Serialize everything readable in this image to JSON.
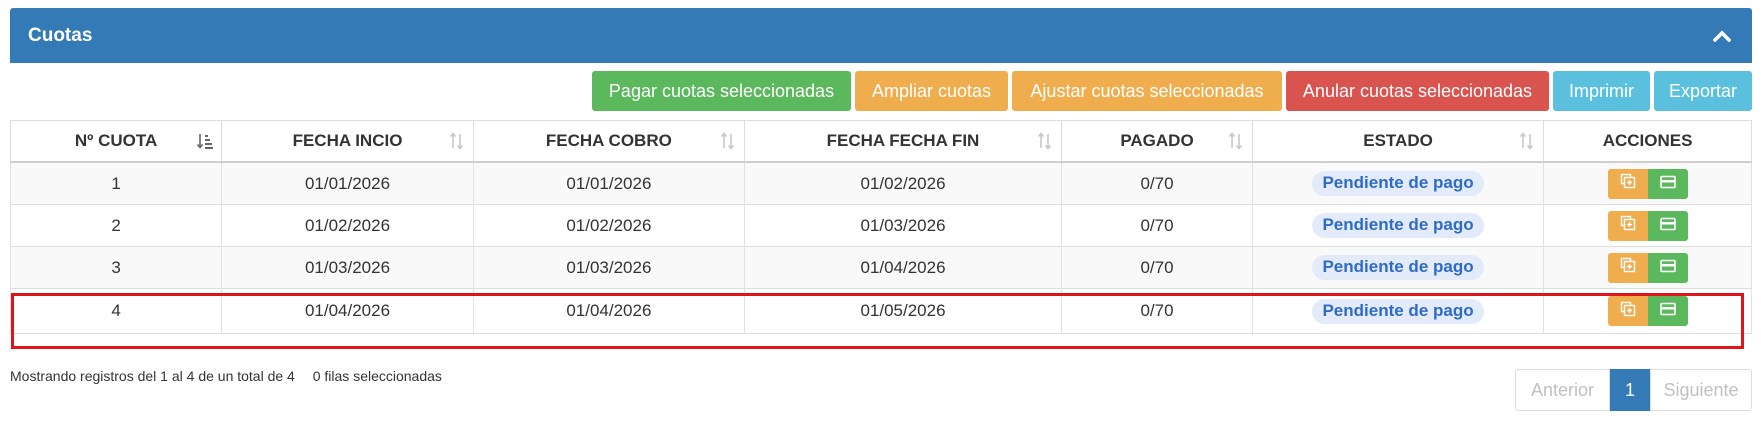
{
  "panel": {
    "title": "Cuotas",
    "collapse_icon": "chevron-up-icon"
  },
  "toolbar": {
    "pay_selected": "Pagar cuotas seleccionadas",
    "extend": "Ampliar cuotas",
    "adjust_selected": "Ajustar cuotas seleccionadas",
    "cancel_selected": "Anular cuotas seleccionadas",
    "print": "Imprimir",
    "export": "Exportar"
  },
  "table": {
    "headers": [
      "Nº CUOTA",
      "FECHA INCIO",
      "FECHA COBRO",
      "FECHA FECHA FIN",
      "PAGADO",
      "ESTADO",
      "ACCIONES"
    ],
    "rows": [
      {
        "cuota": "1",
        "inicio": "01/01/2026",
        "cobro": "01/01/2026",
        "fin": "01/02/2026",
        "pagado": "0/70",
        "estado": "Pendiente de pago"
      },
      {
        "cuota": "2",
        "inicio": "01/02/2026",
        "cobro": "01/02/2026",
        "fin": "01/03/2026",
        "pagado": "0/70",
        "estado": "Pendiente de pago"
      },
      {
        "cuota": "3",
        "inicio": "01/03/2026",
        "cobro": "01/03/2026",
        "fin": "01/04/2026",
        "pagado": "0/70",
        "estado": "Pendiente de pago"
      },
      {
        "cuota": "4",
        "inicio": "01/04/2026",
        "cobro": "01/04/2026",
        "fin": "01/05/2026",
        "pagado": "0/70",
        "estado": "Pendiente de pago"
      }
    ],
    "highlighted_row": "4"
  },
  "footer": {
    "info": "Mostrando registros del 1 al 4 de un total de 4",
    "selected": "0 filas seleccionadas"
  },
  "pagination": {
    "prev": "Anterior",
    "current": "1",
    "next": "Siguiente"
  },
  "colors": {
    "primary": "#337ab7",
    "success": "#5cb85c",
    "warning": "#f0ad4e",
    "danger": "#d9534f",
    "info": "#5bc0de",
    "highlight": "#e0141b"
  }
}
